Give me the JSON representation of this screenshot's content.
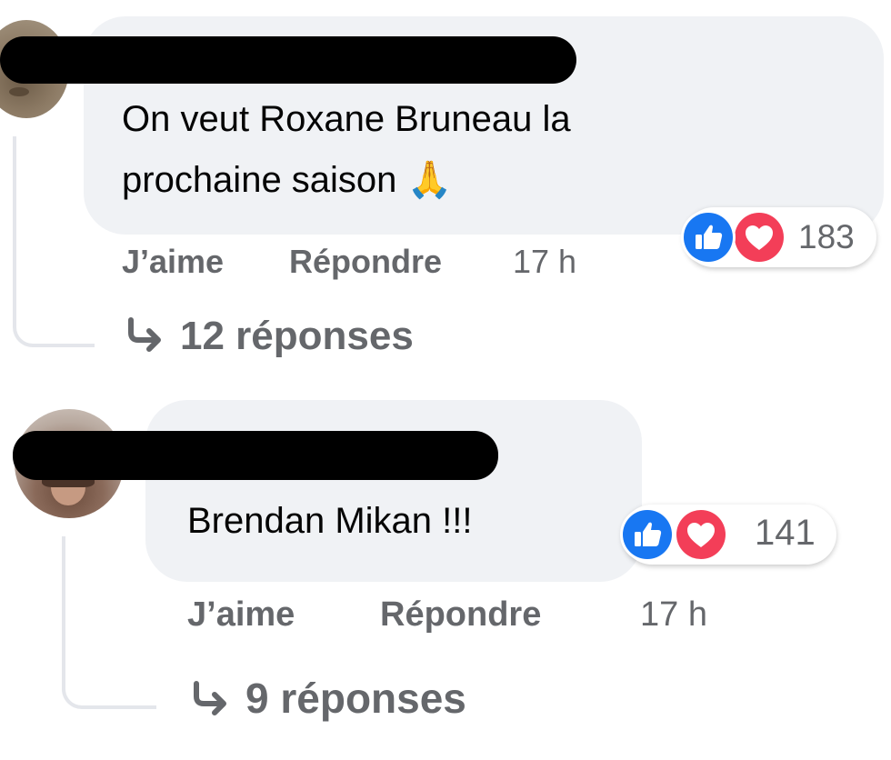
{
  "comments": [
    {
      "text_line1": "On veut Roxane Bruneau la",
      "text_line2": "prochaine saison",
      "emoji": "🙏",
      "reaction_count": "183",
      "like_label": "J’aime",
      "reply_label": "Répondre",
      "time": "17 h",
      "replies_label": "12 réponses"
    },
    {
      "text_line1": "Brendan Mikan !!!",
      "reaction_count": "141",
      "like_label": "J’aime",
      "reply_label": "Répondre",
      "time": "17 h",
      "replies_label": "9 réponses"
    }
  ],
  "colors": {
    "like_blue": "#1877f2",
    "love_red": "#f33e58",
    "bubble_bg": "#f0f2f5",
    "secondary_text": "#65676b"
  },
  "icons": [
    "like-reaction-icon",
    "love-reaction-icon",
    "reply-arrow-icon"
  ]
}
